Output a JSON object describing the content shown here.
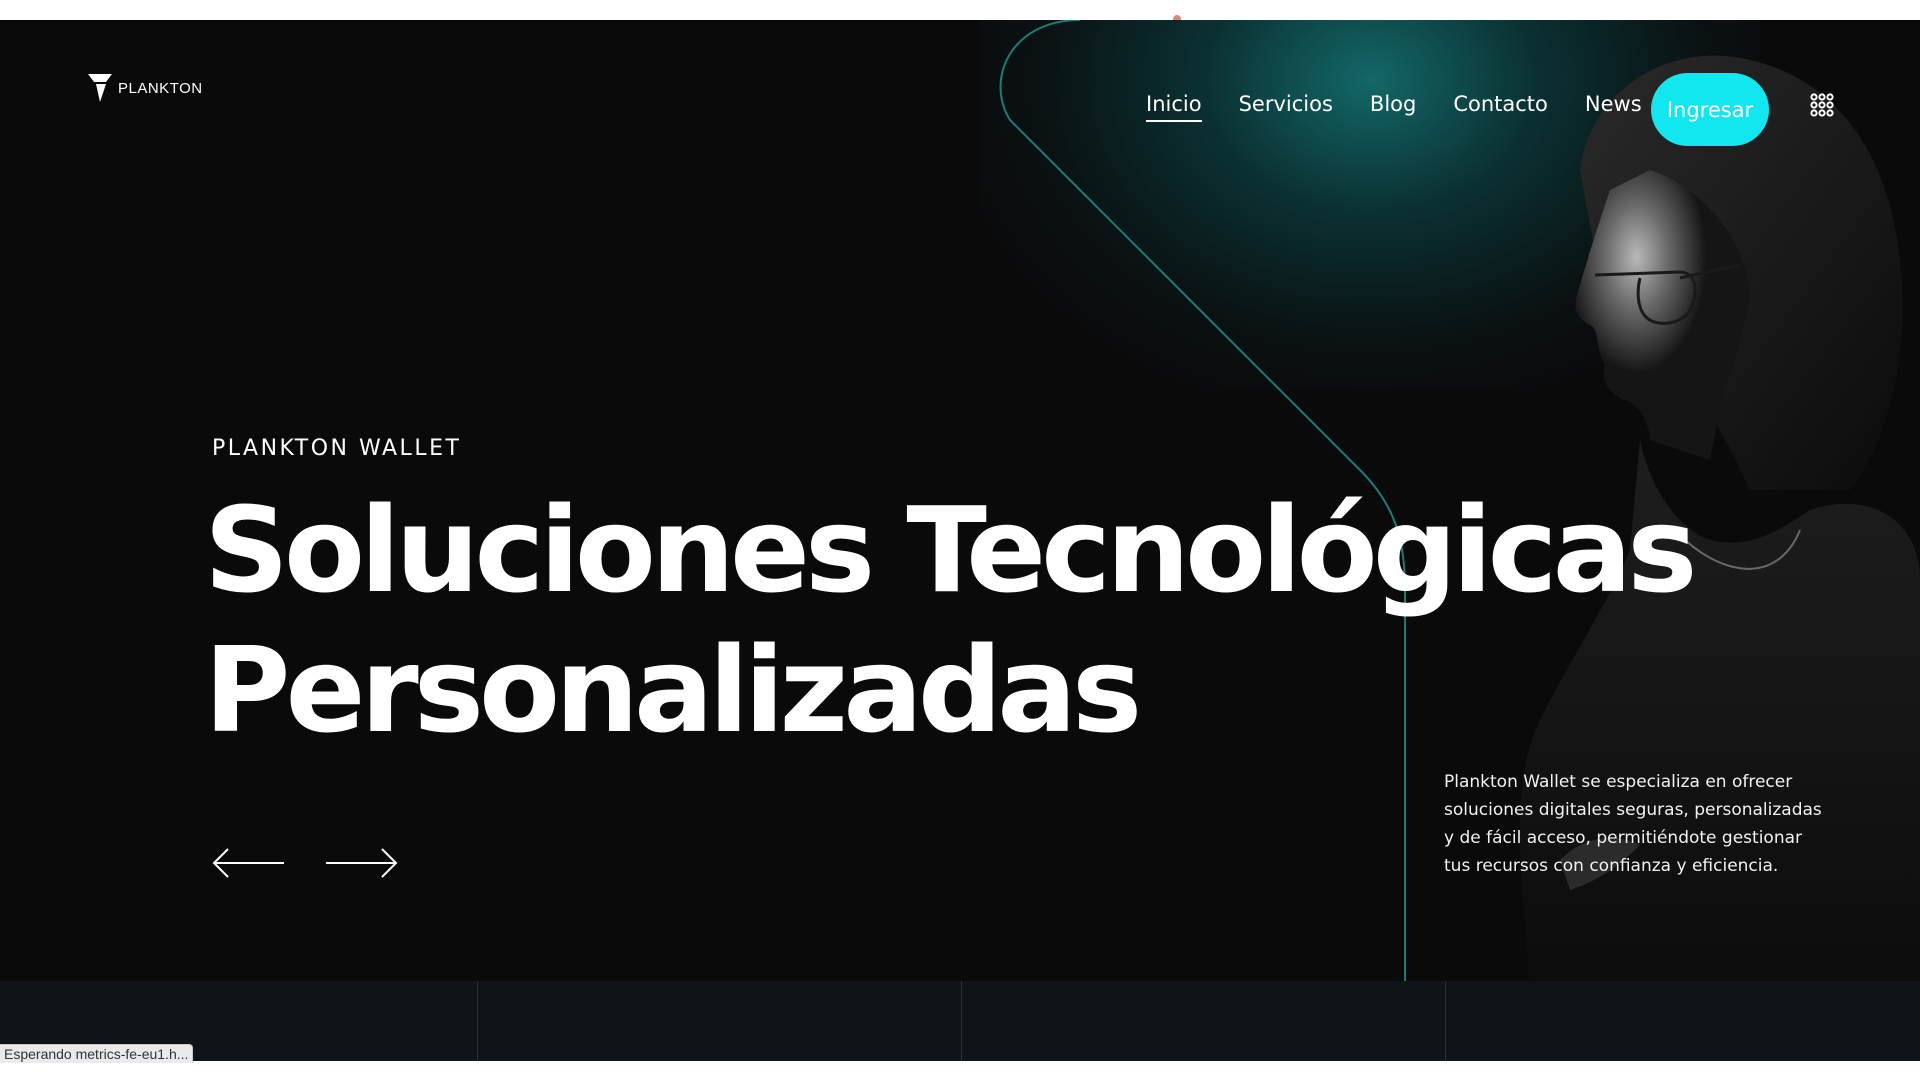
{
  "brand": {
    "name": "PLANKTON",
    "logo_icon": "plankton-logo-icon"
  },
  "nav": {
    "items": [
      {
        "label": "Inicio",
        "active": true
      },
      {
        "label": "Servicios",
        "active": false
      },
      {
        "label": "Blog",
        "active": false
      },
      {
        "label": "Contacto",
        "active": false
      },
      {
        "label": "News",
        "active": false
      }
    ],
    "login_label": "Ingresar",
    "menu_icon": "grid-dots-icon"
  },
  "hero": {
    "kicker": "PLANKTON WALLET",
    "headline_line1": "Soluciones Tecnológicas",
    "headline_line2": "Personalizadas",
    "description": "Plankton Wallet se especializa en ofrecer soluciones digitales seguras, personalizadas y de fácil acceso, permitiéndote gestionar tus recursos con confianza y eficiencia.",
    "prev_icon": "arrow-left-icon",
    "next_icon": "arrow-right-icon"
  },
  "status_bar": {
    "text": "Esperando metrics-fe-eu1.h..."
  },
  "colors": {
    "background": "#0a0a0b",
    "accent": "#12e6ee",
    "glow": "#147878",
    "band": "#0f1418"
  }
}
